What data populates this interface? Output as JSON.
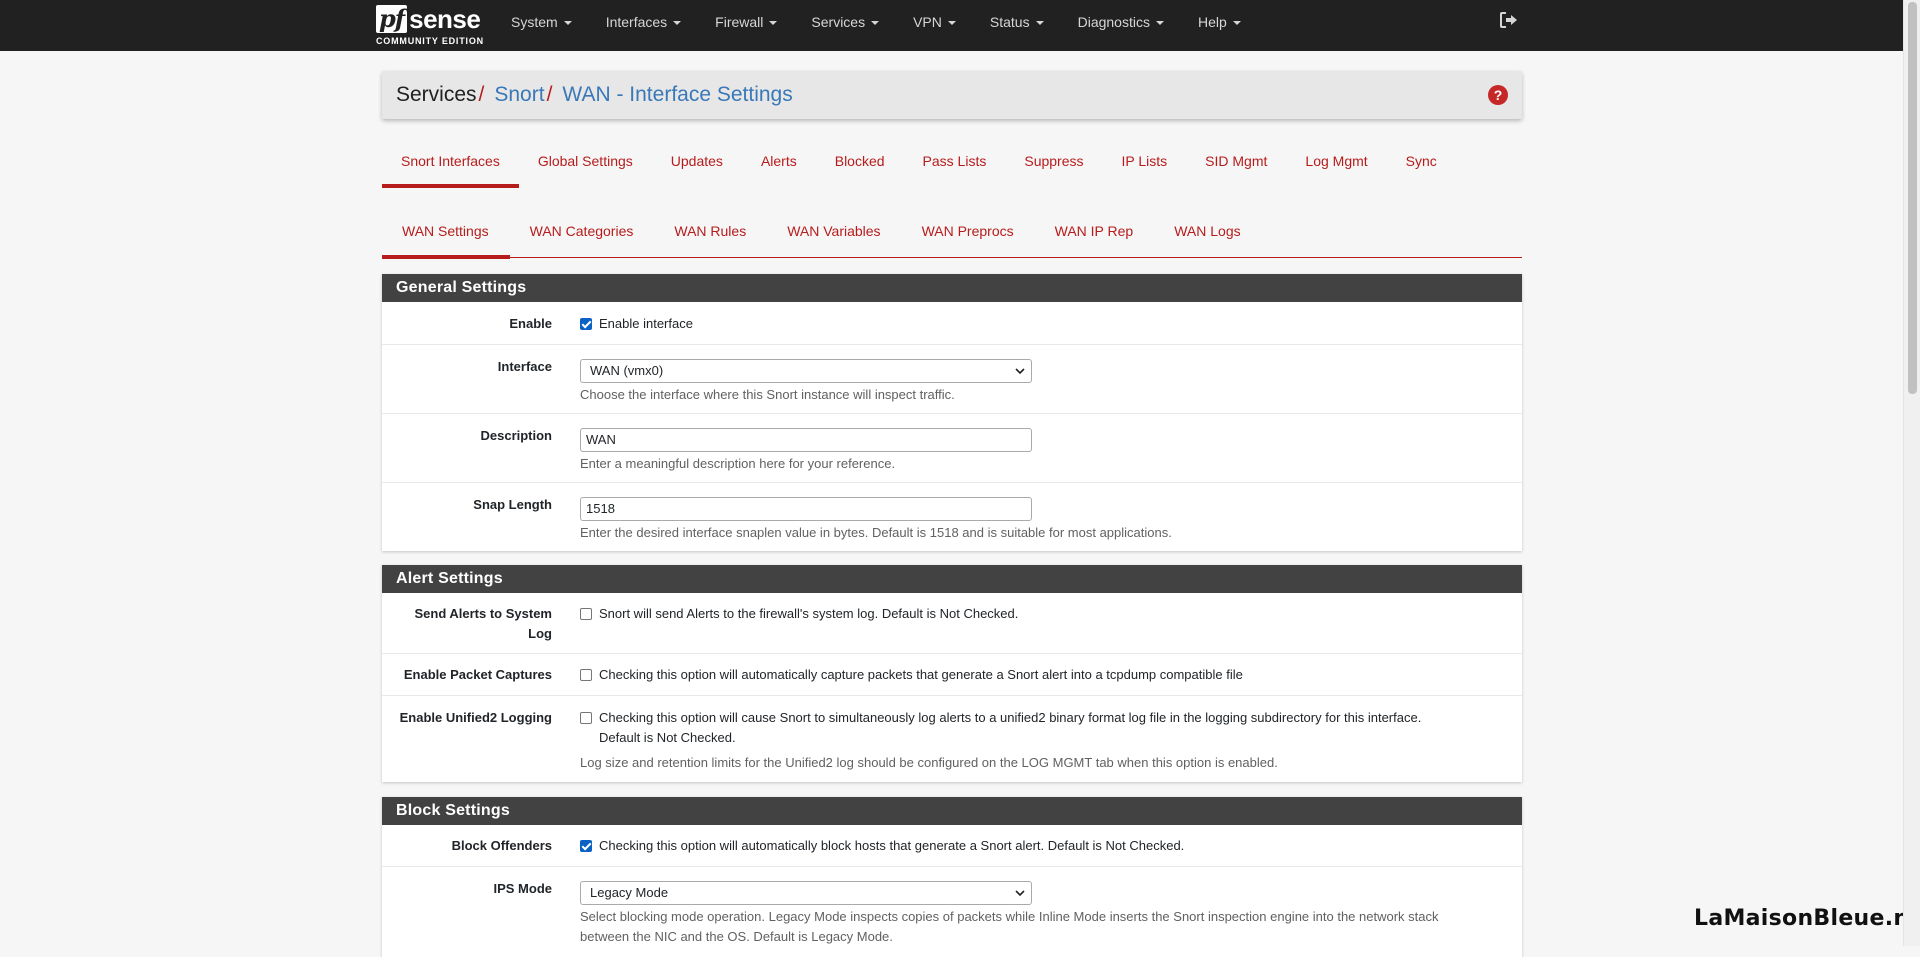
{
  "brand": {
    "logo_prefix": "pf",
    "logo_suffix": "sense",
    "edition": "COMMUNITY EDITION"
  },
  "nav": {
    "items": [
      "System",
      "Interfaces",
      "Firewall",
      "Services",
      "VPN",
      "Status",
      "Diagnostics",
      "Help"
    ],
    "logout_icon": "sign-out-icon"
  },
  "breadcrumb": {
    "section": "Services",
    "sep": "/",
    "package": "Snort",
    "page": "WAN - Interface Settings",
    "help_glyph": "?"
  },
  "tabs_main": [
    "Snort Interfaces",
    "Global Settings",
    "Updates",
    "Alerts",
    "Blocked",
    "Pass Lists",
    "Suppress",
    "IP Lists",
    "SID Mgmt",
    "Log Mgmt",
    "Sync"
  ],
  "tabs_iface": [
    "WAN Settings",
    "WAN Categories",
    "WAN Rules",
    "WAN Variables",
    "WAN Preprocs",
    "WAN IP Rep",
    "WAN Logs"
  ],
  "general": {
    "title": "General Settings",
    "enable": {
      "label": "Enable",
      "checkbox_text": "Enable interface",
      "checked": true
    },
    "interface": {
      "label": "Interface",
      "value": "WAN (vmx0)",
      "hint": "Choose the interface where this Snort instance will inspect traffic."
    },
    "description": {
      "label": "Description",
      "value": "WAN",
      "hint": "Enter a meaningful description here for your reference."
    },
    "snaplen": {
      "label": "Snap Length",
      "value": "1518",
      "hint": "Enter the desired interface snaplen value in bytes. Default is 1518 and is suitable for most applications."
    }
  },
  "alert": {
    "title": "Alert Settings",
    "syslog": {
      "label_line1": "Send Alerts to System",
      "label_line2": "Log",
      "text": "Snort will send Alerts to the firewall's system log. Default is Not Checked.",
      "checked": false
    },
    "pcap": {
      "label": "Enable Packet Captures",
      "text": "Checking this option will automatically capture packets that generate a Snort alert into a tcpdump compatible file",
      "checked": false
    },
    "unified2": {
      "label": "Enable Unified2 Logging",
      "text_line1": "Checking this option will cause Snort to simultaneously log alerts to a unified2 binary format log file in the logging subdirectory for this interface.",
      "text_line2": "Default is Not Checked.",
      "hint": "Log size and retention limits for the Unified2 log should be configured on the LOG MGMT tab when this option is enabled.",
      "checked": false
    }
  },
  "block": {
    "title": "Block Settings",
    "offenders": {
      "label": "Block Offenders",
      "text": "Checking this option will automatically block hosts that generate a Snort alert. Default is Not Checked.",
      "checked": true
    },
    "ips_mode": {
      "label": "IPS Mode",
      "value": "Legacy Mode",
      "hint_line1": "Select blocking mode operation. Legacy Mode inspects copies of packets while Inline Mode inserts the Snort inspection engine into the network stack",
      "hint_line2": "between the NIC and the OS. Default is Legacy Mode."
    }
  },
  "watermark": "LaMaisonBleue.net",
  "colors": {
    "accent": "#b71c1c",
    "navbar": "#212121",
    "panel_head": "#424242",
    "link": "#3a78b8",
    "checkbox": "#0b61c4"
  }
}
